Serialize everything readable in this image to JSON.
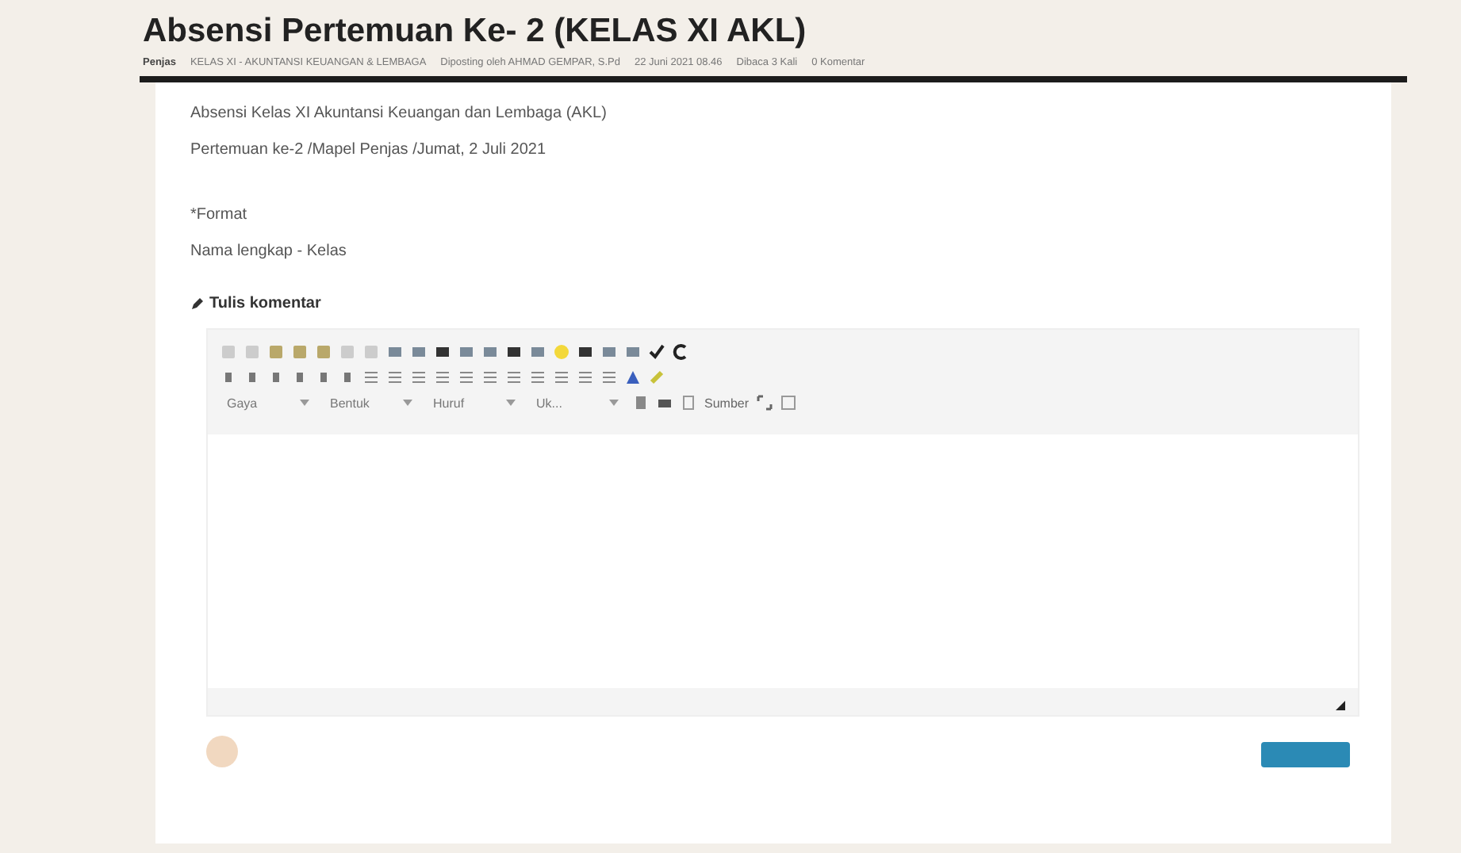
{
  "post": {
    "title": "Absensi Pertemuan Ke- 2 (KELAS XI AKL)",
    "meta": [
      "Penjas",
      "KELAS XI - AKUNTANSI KEUANGAN & LEMBAGA",
      "Diposting oleh AHMAD GEMPAR, S.Pd",
      "22 Juni 2021 08.46",
      "Dibaca 3 Kali",
      "0 Komentar"
    ],
    "body": [
      "Absensi Kelas XI Akuntansi Keuangan dan Lembaga (AKL)",
      "Pertemuan ke-2 /Mapel Penjas /Jumat, 2 Juli 2021",
      "*Format",
      "Nama lengkap - Kelas"
    ]
  },
  "comment": {
    "heading": "Tulis komentar",
    "dropdowns": [
      "Gaya",
      "Bentuk",
      "Huruf",
      "Uk..."
    ],
    "source_button": "Sumber"
  }
}
